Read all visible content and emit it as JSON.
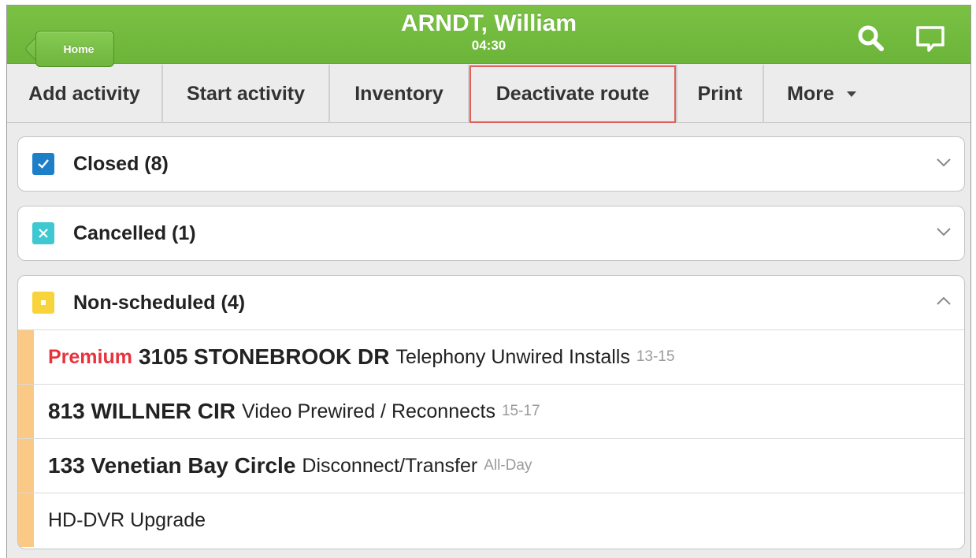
{
  "header": {
    "home_label": "Home",
    "title": "ARNDT, William",
    "time": "04:30",
    "bg_color": "#6cb53a",
    "icons": [
      "search-icon",
      "chat-icon"
    ]
  },
  "toolbar": {
    "buttons": [
      {
        "label": "Add activity"
      },
      {
        "label": "Start activity"
      },
      {
        "label": "Inventory"
      },
      {
        "label": "Deactivate route",
        "highlighted": true
      },
      {
        "label": "Print"
      },
      {
        "label": "More"
      }
    ]
  },
  "sections": [
    {
      "title": "Closed (8)",
      "status_color": "#1e7fc9",
      "icon": "check-icon",
      "expanded": false
    },
    {
      "title": "Cancelled (1)",
      "status_color": "#3fc8d2",
      "icon": "x-icon",
      "expanded": false
    },
    {
      "title": "Non-scheduled (4)",
      "status_color": "#f7d43b",
      "icon": "square-icon",
      "expanded": true,
      "rows": [
        {
          "priority": "Premium",
          "address": "3105 STONEBROOK DR",
          "type": "Telephony Unwired Installs",
          "window": "13-15"
        },
        {
          "priority": "",
          "address": "813 WILLNER CIR",
          "type": "Video Prewired / Reconnects",
          "window": "15-17"
        },
        {
          "priority": "",
          "address": "133 Venetian Bay Circle",
          "type": "Disconnect/Transfer",
          "window": "All-Day"
        },
        {
          "priority": "",
          "address": "",
          "type": "HD-DVR Upgrade",
          "window": ""
        }
      ]
    }
  ]
}
